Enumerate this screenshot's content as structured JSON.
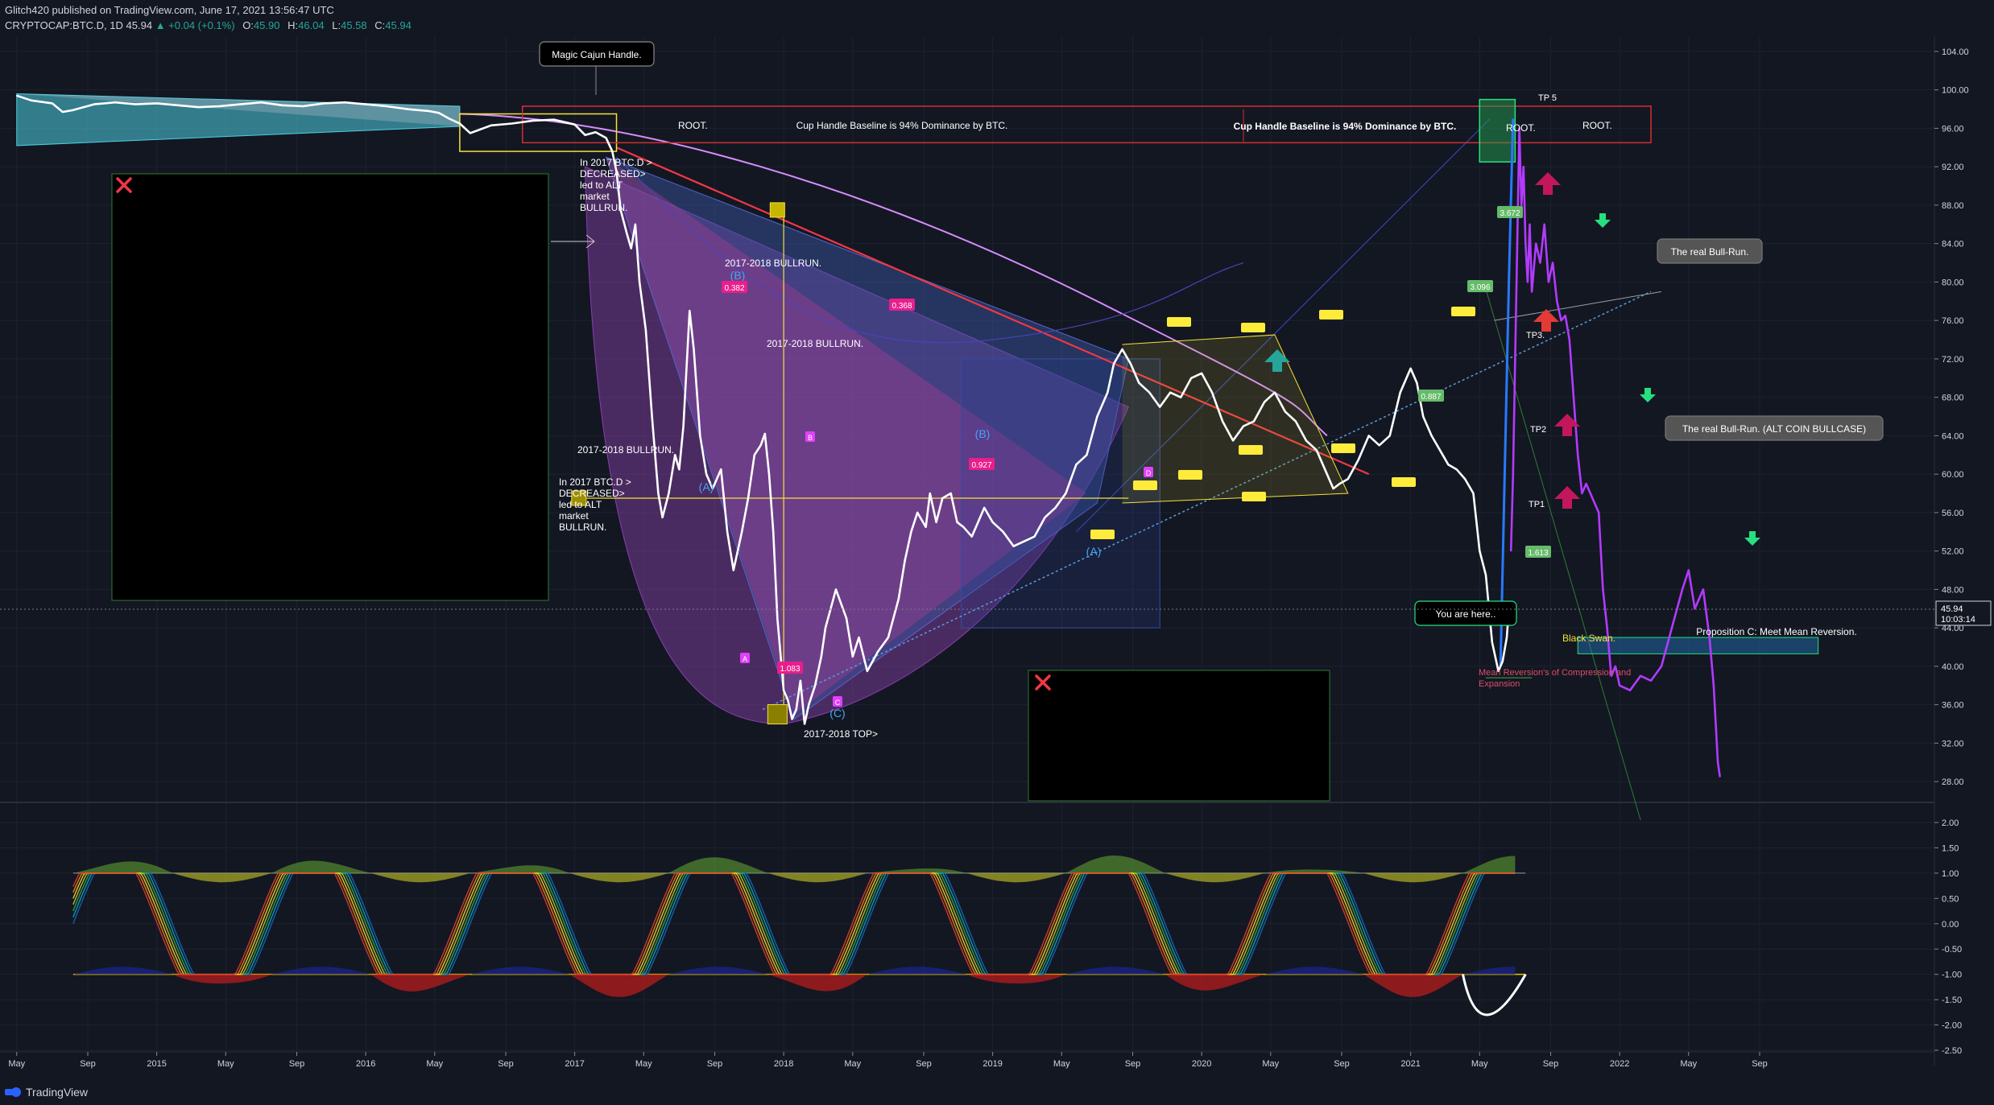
{
  "header": {
    "line1": "Glitch420 published on TradingView.com, June 17, 2021 13:56:47 UTC",
    "symbol": "CRYPTOCAP:BTC.D, 1D",
    "last": "45.94",
    "change": "▲ +0.04 (+0.1%)",
    "o_label": "O:",
    "o_val": "45.90",
    "h_label": "H:",
    "h_val": "46.04",
    "l_label": "L:",
    "l_val": "45.58",
    "c_label": "C:",
    "c_val": "45.94"
  },
  "footer": {
    "brand": "TradingView"
  },
  "colors": {
    "background": "#131722",
    "price": "#ffffff",
    "grid": "#1e2230",
    "cyan": "#4dd0e1",
    "magenta": "#e040fb",
    "yellow": "#f5e13c",
    "red": "#f23645",
    "green": "#26e07f",
    "purple": "#b13bff"
  },
  "chart_data": [
    {
      "type": "line",
      "symbol": "CRYPTOCAP:BTC.D",
      "x_ticks": [
        "May",
        "Sep",
        "2015",
        "May",
        "Sep",
        "2016",
        "May",
        "Sep",
        "2017",
        "May",
        "Sep",
        "2018",
        "May",
        "Sep",
        "2019",
        "May",
        "Sep",
        "2020",
        "May",
        "Sep",
        "2021",
        "May",
        "Sep",
        "2022",
        "May",
        "Sep"
      ],
      "y_ticks": [
        "104.00",
        "100.00",
        "96.00",
        "92.00",
        "88.00",
        "84.00",
        "80.00",
        "76.00",
        "72.00",
        "68.00",
        "64.00",
        "60.00",
        "56.00",
        "52.00",
        "48.00",
        "44.00",
        "40.00",
        "36.00",
        "32.00",
        "28.00"
      ],
      "ylim": [
        26,
        105
      ],
      "xlim": [
        2014.25,
        2023.5
      ],
      "current_price": "45.94",
      "countdown": "10:03:14",
      "series": [
        {
          "values": [
            [
              2014.33,
              99.4
            ],
            [
              2014.4,
              98.9
            ],
            [
              2014.5,
              98.6
            ],
            [
              2014.55,
              97.7
            ],
            [
              2014.6,
              97.9
            ],
            [
              2014.7,
              98.5
            ],
            [
              2014.8,
              98.7
            ],
            [
              2014.9,
              98.5
            ],
            [
              2015.0,
              98.6
            ],
            [
              2015.1,
              98.4
            ],
            [
              2015.2,
              98.2
            ],
            [
              2015.3,
              98.3
            ],
            [
              2015.4,
              98.5
            ],
            [
              2015.5,
              98.7
            ],
            [
              2015.6,
              98.4
            ],
            [
              2015.7,
              98.3
            ],
            [
              2015.8,
              98.6
            ],
            [
              2015.9,
              98.7
            ],
            [
              2016.0,
              98.5
            ],
            [
              2016.1,
              98.3
            ],
            [
              2016.2,
              98.0
            ],
            [
              2016.3,
              97.8
            ],
            [
              2016.35,
              97.6
            ],
            [
              2016.4,
              97.0
            ],
            [
              2016.45,
              96.5
            ],
            [
              2016.5,
              95.5
            ],
            [
              2016.55,
              95.9
            ],
            [
              2016.6,
              96.3
            ],
            [
              2016.7,
              96.5
            ],
            [
              2016.8,
              96.8
            ],
            [
              2016.9,
              96.9
            ],
            [
              2017.0,
              96.4
            ],
            [
              2017.05,
              95.3
            ],
            [
              2017.1,
              95.6
            ],
            [
              2017.15,
              95.0
            ],
            [
              2017.18,
              93.6
            ],
            [
              2017.2,
              91.5
            ],
            [
              2017.22,
              87.5
            ],
            [
              2017.25,
              85.0
            ],
            [
              2017.27,
              83.5
            ],
            [
              2017.29,
              86.0
            ],
            [
              2017.31,
              80.0
            ],
            [
              2017.34,
              75.0
            ],
            [
              2017.37,
              66.0
            ],
            [
              2017.4,
              58.0
            ],
            [
              2017.42,
              55.5
            ],
            [
              2017.45,
              58.0
            ],
            [
              2017.48,
              62.0
            ],
            [
              2017.5,
              60.5
            ],
            [
              2017.52,
              65.0
            ],
            [
              2017.55,
              77.0
            ],
            [
              2017.57,
              73.0
            ],
            [
              2017.6,
              64.0
            ],
            [
              2017.63,
              60.0
            ],
            [
              2017.66,
              58.5
            ],
            [
              2017.7,
              60.5
            ],
            [
              2017.73,
              54.0
            ],
            [
              2017.76,
              50.0
            ],
            [
              2017.8,
              54.0
            ],
            [
              2017.83,
              57.5
            ],
            [
              2017.86,
              62.0
            ],
            [
              2017.89,
              63.0
            ],
            [
              2017.91,
              64.2
            ],
            [
              2017.93,
              60.0
            ],
            [
              2017.95,
              54.0
            ],
            [
              2017.97,
              45.0
            ],
            [
              2017.99,
              40.0
            ],
            [
              2018.0,
              37.5
            ],
            [
              2018.02,
              36.5
            ],
            [
              2018.04,
              34.5
            ],
            [
              2018.06,
              35.5
            ],
            [
              2018.08,
              38.5
            ],
            [
              2018.1,
              34.0
            ],
            [
              2018.12,
              36.0
            ],
            [
              2018.15,
              38.0
            ],
            [
              2018.18,
              41.0
            ],
            [
              2018.2,
              44.0
            ],
            [
              2018.25,
              48.0
            ],
            [
              2018.3,
              45.0
            ],
            [
              2018.33,
              41.0
            ],
            [
              2018.36,
              43.0
            ],
            [
              2018.4,
              39.5
            ],
            [
              2018.45,
              41.5
            ],
            [
              2018.5,
              43.0
            ],
            [
              2018.55,
              47.0
            ],
            [
              2018.58,
              51.0
            ],
            [
              2018.61,
              54.0
            ],
            [
              2018.64,
              56.0
            ],
            [
              2018.68,
              54.5
            ],
            [
              2018.7,
              58.0
            ],
            [
              2018.73,
              55.0
            ],
            [
              2018.76,
              57.5
            ],
            [
              2018.8,
              58.0
            ],
            [
              2018.83,
              55.0
            ],
            [
              2018.86,
              54.5
            ],
            [
              2018.9,
              53.5
            ],
            [
              2018.93,
              55.0
            ],
            [
              2018.96,
              56.5
            ],
            [
              2019.0,
              55.0
            ],
            [
              2019.05,
              54.0
            ],
            [
              2019.1,
              52.5
            ],
            [
              2019.15,
              53.0
            ],
            [
              2019.2,
              53.5
            ],
            [
              2019.25,
              55.5
            ],
            [
              2019.3,
              56.5
            ],
            [
              2019.35,
              58.0
            ],
            [
              2019.4,
              61.0
            ],
            [
              2019.45,
              62.0
            ],
            [
              2019.5,
              66.0
            ],
            [
              2019.55,
              68.5
            ],
            [
              2019.58,
              71.5
            ],
            [
              2019.62,
              73.0
            ],
            [
              2019.66,
              71.5
            ],
            [
              2019.7,
              69.5
            ],
            [
              2019.75,
              68.5
            ],
            [
              2019.8,
              67.0
            ],
            [
              2019.85,
              68.5
            ],
            [
              2019.9,
              68.0
            ],
            [
              2019.95,
              70.0
            ],
            [
              2020.0,
              70.5
            ],
            [
              2020.05,
              68.5
            ],
            [
              2020.1,
              65.5
            ],
            [
              2020.15,
              63.5
            ],
            [
              2020.2,
              65.0
            ],
            [
              2020.25,
              65.5
            ],
            [
              2020.3,
              67.5
            ],
            [
              2020.35,
              68.5
            ],
            [
              2020.4,
              66.5
            ],
            [
              2020.45,
              65.5
            ],
            [
              2020.5,
              63.5
            ],
            [
              2020.55,
              62.5
            ],
            [
              2020.6,
              60.0
            ],
            [
              2020.63,
              58.5
            ],
            [
              2020.66,
              59.0
            ],
            [
              2020.7,
              59.5
            ],
            [
              2020.75,
              61.5
            ],
            [
              2020.8,
              64.0
            ],
            [
              2020.85,
              63.0
            ],
            [
              2020.9,
              64.0
            ],
            [
              2020.95,
              68.5
            ],
            [
              2021.0,
              71.0
            ],
            [
              2021.03,
              69.5
            ],
            [
              2021.06,
              66.0
            ],
            [
              2021.1,
              64.0
            ],
            [
              2021.14,
              62.5
            ],
            [
              2021.18,
              61.0
            ],
            [
              2021.22,
              60.5
            ],
            [
              2021.26,
              59.5
            ],
            [
              2021.3,
              58.0
            ],
            [
              2021.33,
              52.0
            ],
            [
              2021.36,
              49.5
            ],
            [
              2021.39,
              42.5
            ],
            [
              2021.42,
              39.5
            ],
            [
              2021.44,
              40.5
            ],
            [
              2021.46,
              43.0
            ],
            [
              2021.47,
              45.94
            ]
          ]
        },
        {
          "values": [
            [
              2021.48,
              52.0
            ],
            [
              2021.49,
              60.0
            ],
            [
              2021.5,
              72.0
            ],
            [
              2021.51,
              84.0
            ],
            [
              2021.52,
              96.0
            ],
            [
              2021.53,
              88.0
            ],
            [
              2021.54,
              92.0
            ],
            [
              2021.55,
              84.0
            ],
            [
              2021.56,
              80.0
            ],
            [
              2021.57,
              86.0
            ],
            [
              2021.58,
              79.0
            ],
            [
              2021.6,
              84.0
            ],
            [
              2021.62,
              82.0
            ],
            [
              2021.64,
              86.0
            ],
            [
              2021.66,
              80.0
            ],
            [
              2021.68,
              82.0
            ],
            [
              2021.7,
              78.0
            ],
            [
              2021.72,
              76.0
            ],
            [
              2021.74,
              76.5
            ],
            [
              2021.76,
              74.0
            ],
            [
              2021.78,
              68.0
            ],
            [
              2021.8,
              62.0
            ],
            [
              2021.82,
              58.0
            ],
            [
              2021.84,
              59.0
            ],
            [
              2021.86,
              58.0
            ],
            [
              2021.88,
              57.0
            ],
            [
              2021.9,
              56.0
            ],
            [
              2021.92,
              48.0
            ],
            [
              2021.94,
              44.0
            ],
            [
              2021.96,
              39.0
            ],
            [
              2021.98,
              40.0
            ],
            [
              2022.0,
              38.0
            ],
            [
              2022.05,
              37.5
            ],
            [
              2022.1,
              39.0
            ],
            [
              2022.15,
              38.5
            ],
            [
              2022.2,
              40.0
            ],
            [
              2022.25,
              44.0
            ],
            [
              2022.3,
              48.0
            ],
            [
              2022.33,
              50.0
            ],
            [
              2022.36,
              46.0
            ],
            [
              2022.4,
              48.0
            ],
            [
              2022.43,
              43.0
            ],
            [
              2022.45,
              38.0
            ],
            [
              2022.47,
              30.0
            ],
            [
              2022.48,
              28.5
            ]
          ]
        }
      ],
      "annotations": {
        "magic_handle": "Magic Cajun Handle.",
        "root": "ROOT.",
        "cup_handle": "Cup Handle Baseline is 94% Dominance by BTC.",
        "in2017": "In 2017 BTC.D >\nDECREASED>\nled to ALT\nmarket\nBULLRUN.",
        "in2017b": "In 2017 BTC.D >\nDECREASED>\nled to ALT\nmarket\nBULLRUN.",
        "bullrun": "2017-2018 BULLRUN.",
        "top": "2017-2018 TOP>",
        "real_bullrun": "The real Bull-Run.",
        "real_bullrun_alt": "The real Bull-Run. (ALT COIN BULLCASE)",
        "you_are_here": "You are here..",
        "black_swan": "Black Swan.",
        "mean_rev": "Mean Reversion's of Compression and\nExpansion",
        "proposition": "Proposition C: Meet Mean Reversion.",
        "tp5": "TP 5",
        "tp3": "TP3.",
        "tp2": "TP2",
        "tp1": "TP1",
        "wave_b": "(B)",
        "wave_a": "(A)",
        "wave_c": "(C)",
        "fib": [
          "0.382",
          "0.368",
          "1.083",
          "0.927",
          "3.672",
          "3.096",
          "0.887",
          "1.613"
        ],
        "pts": [
          "A",
          "B",
          "C",
          "D"
        ]
      }
    },
    {
      "type": "area",
      "name": "oscillator",
      "y_ticks": [
        "2.00",
        "1.50",
        "1.00",
        "0.50",
        "0.00",
        "-0.50",
        "-1.00",
        "-1.50",
        "-2.00",
        "-2.50"
      ],
      "ylim": [
        -2.5,
        2.2
      ],
      "cycle_troughs": [
        2014.65,
        2015.65,
        2016.6,
        2017.55,
        2018.35,
        2019.1,
        2019.85,
        2020.6,
        2021.4
      ],
      "cycle_peaks": [
        2014.95,
        2016.0,
        2016.95,
        2017.85,
        2018.65,
        2019.45,
        2020.2,
        2021.0
      ]
    }
  ]
}
